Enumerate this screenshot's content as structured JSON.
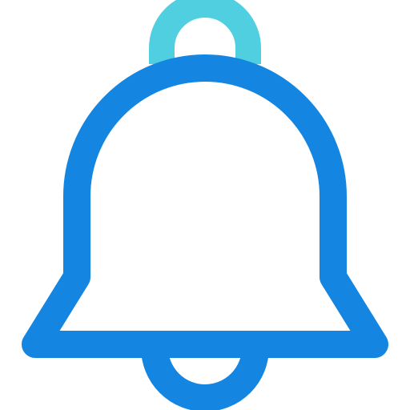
{
  "icon": {
    "name": "bell-icon",
    "colors": {
      "primary": "#1485e0",
      "accent": "#4fcfe0",
      "background": "#ffffff"
    }
  }
}
